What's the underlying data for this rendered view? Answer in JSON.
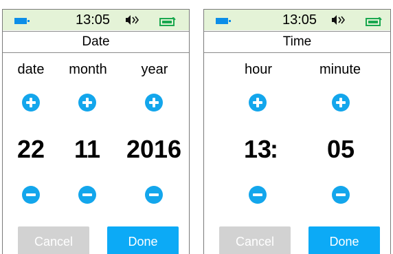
{
  "screens": [
    {
      "status": {
        "time": "13:05"
      },
      "title": "Date",
      "columns": [
        {
          "label": "date",
          "value": "22"
        },
        {
          "label": "month",
          "value": "11"
        },
        {
          "label": "year",
          "value": "2016"
        }
      ],
      "cancel_label": "Cancel",
      "done_label": "Done"
    },
    {
      "status": {
        "time": "13:05"
      },
      "title": "Time",
      "columns": [
        {
          "label": "hour",
          "value": "13"
        },
        {
          "label": "minute",
          "value": "05"
        }
      ],
      "separator": ":",
      "cancel_label": "Cancel",
      "done_label": "Done"
    }
  ],
  "icons": {
    "battery": "battery-icon",
    "speaker": "speaker-icon",
    "phone_battery": "phone-battery-icon",
    "increase": "plus-circle-icon",
    "decrease": "minus-circle-icon"
  },
  "colors": {
    "accent": "#13a6ec",
    "done_button": "#0caaf6",
    "cancel_button": "#d2d2d2",
    "status_bar": "#e4f3d7",
    "battery": "#0c8ee8",
    "phone_battery": "#1aa84f"
  }
}
